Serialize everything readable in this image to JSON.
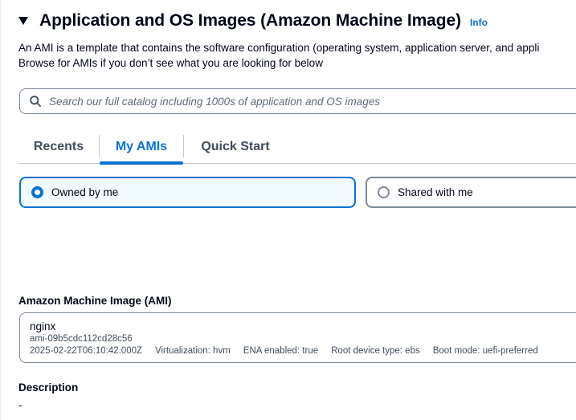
{
  "section": {
    "title": "Application and OS Images (Amazon Machine Image)",
    "info_link": "Info",
    "description_line1": "An AMI is a template that contains the software configuration (operating system, application server, and appli",
    "description_line2": "Browse for AMIs if you don’t see what you are looking for below"
  },
  "search": {
    "placeholder": "Search our full catalog including 1000s of application and OS images",
    "value": ""
  },
  "tabs": [
    {
      "label": "Recents",
      "active": false
    },
    {
      "label": "My AMIs",
      "active": true
    },
    {
      "label": "Quick Start",
      "active": false
    }
  ],
  "ownership": {
    "options": [
      {
        "label": "Owned by me",
        "selected": true
      },
      {
        "label": "Shared with me",
        "selected": false
      }
    ]
  },
  "ami": {
    "label": "Amazon Machine Image (AMI)",
    "name": "nginx",
    "id": "ami-09b5cdc112cd28c56",
    "created": "2025-02-22T06:10:42.000Z",
    "virtualization": "Virtualization: hvm",
    "ena": "ENA enabled: true",
    "root_device": "Root device type: ebs",
    "boot_mode": "Boot mode: uefi-preferred"
  },
  "details": {
    "description_label": "Description",
    "description_value": "-"
  },
  "colors": {
    "accent": "#0972d3",
    "text": "#000716",
    "border": "#7d8998",
    "selected_bg": "#f1faff"
  }
}
